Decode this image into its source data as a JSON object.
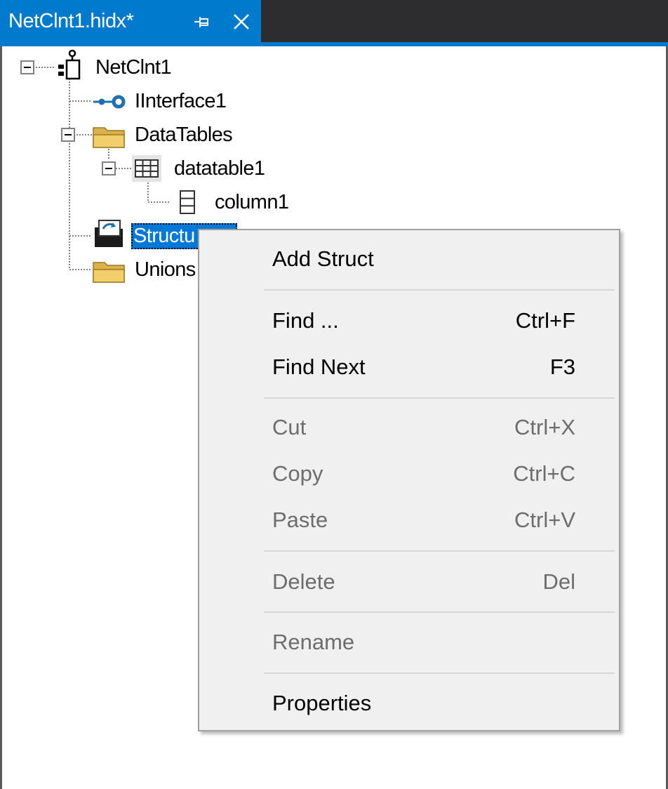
{
  "tab": {
    "title": "NetClnt1.hidx*",
    "pin_icon": "pin-icon",
    "close_icon": "close-icon"
  },
  "tree": {
    "root": {
      "label": "NetClnt1",
      "icon": "client-node-icon"
    },
    "interface": {
      "label": "IInterface1",
      "icon": "interface-lollipop-icon"
    },
    "datatables": {
      "label": "DataTables",
      "icon": "folder-icon"
    },
    "datatable": {
      "label": "datatable1",
      "icon": "table-grid-icon"
    },
    "column": {
      "label": "column1",
      "icon": "column-icon"
    },
    "structs": {
      "label": "Structu",
      "icon": "struct-folder-icon"
    },
    "unions": {
      "label": "Unions",
      "icon": "folder-icon"
    }
  },
  "menu": {
    "items": [
      {
        "label": "Add Struct",
        "shortcut": "",
        "enabled": true
      },
      {
        "label": "Find ...",
        "shortcut": "Ctrl+F",
        "enabled": true
      },
      {
        "label": "Find Next",
        "shortcut": "F3",
        "enabled": true
      },
      {
        "label": "Cut",
        "shortcut": "Ctrl+X",
        "enabled": false
      },
      {
        "label": "Copy",
        "shortcut": "Ctrl+C",
        "enabled": false
      },
      {
        "label": "Paste",
        "shortcut": "Ctrl+V",
        "enabled": false
      },
      {
        "label": "Delete",
        "shortcut": "Del",
        "enabled": false
      },
      {
        "label": "Rename",
        "shortcut": "",
        "enabled": false
      },
      {
        "label": "Properties",
        "shortcut": "",
        "enabled": true
      }
    ]
  },
  "colors": {
    "accent": "#007acc",
    "selection": "#0078d7",
    "tab_bar": "#2d2d30",
    "menu_bg": "#f0f0f0",
    "disabled_text": "#6d6d6d"
  }
}
